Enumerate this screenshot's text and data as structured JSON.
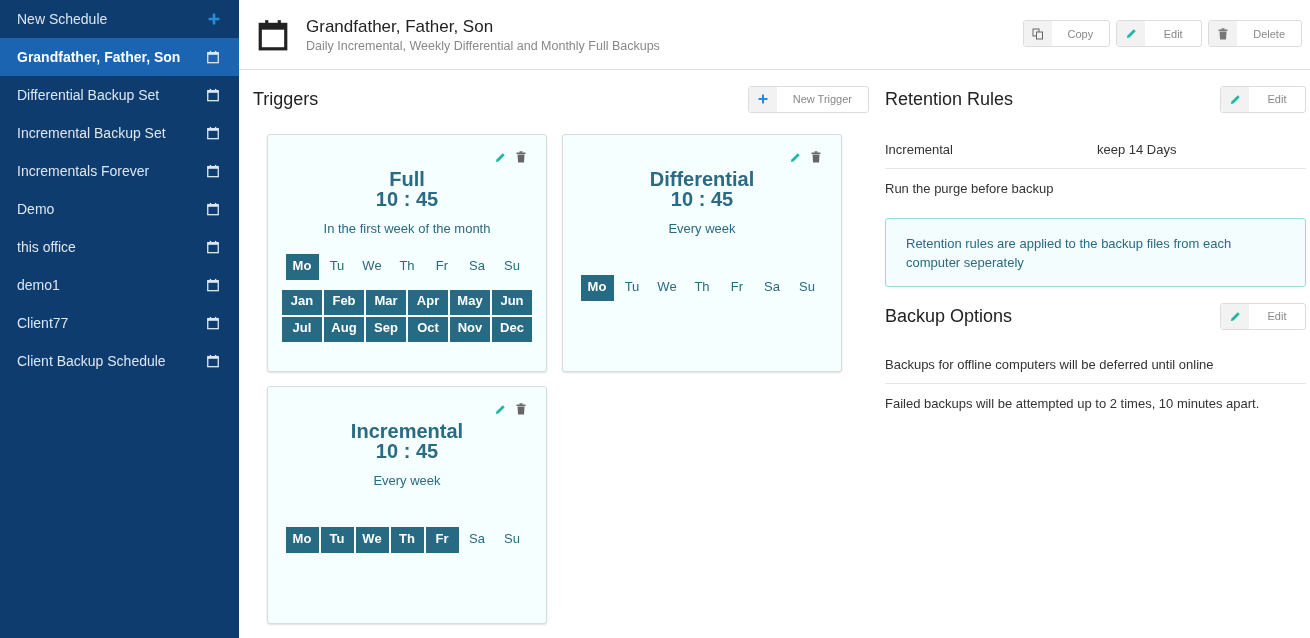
{
  "sidebar": {
    "new_item": {
      "label": "New Schedule"
    },
    "items": [
      {
        "label": "Grandfather, Father, Son",
        "selected": true
      },
      {
        "label": "Differential Backup Set",
        "selected": false
      },
      {
        "label": "Incremental Backup Set",
        "selected": false
      },
      {
        "label": "Incrementals Forever",
        "selected": false
      },
      {
        "label": "Demo",
        "selected": false
      },
      {
        "label": "this office",
        "selected": false
      },
      {
        "label": "demo1",
        "selected": false
      },
      {
        "label": "Client77",
        "selected": false
      },
      {
        "label": "Client Backup Schedule",
        "selected": false
      }
    ]
  },
  "header": {
    "title": "Grandfather, Father, Son",
    "subtitle": "Daily Incremental, Weekly Differential and Monthly Full Backups",
    "buttons": [
      {
        "kind": "copy",
        "label": "Copy"
      },
      {
        "kind": "edit",
        "label": "Edit"
      },
      {
        "kind": "delete",
        "label": "Delete"
      }
    ]
  },
  "triggers": {
    "title": "Triggers",
    "new_button": {
      "label": "New Trigger"
    },
    "cards": [
      {
        "title": "Full",
        "time": "10 : 45",
        "description": "In the first week of the month",
        "days": [
          {
            "label": "Mo",
            "selected": true
          },
          {
            "label": "Tu",
            "selected": false
          },
          {
            "label": "We",
            "selected": false
          },
          {
            "label": "Th",
            "selected": false
          },
          {
            "label": "Fr",
            "selected": false
          },
          {
            "label": "Sa",
            "selected": false
          },
          {
            "label": "Su",
            "selected": false
          }
        ],
        "months": [
          {
            "label": "Jan",
            "selected": true
          },
          {
            "label": "Feb",
            "selected": true
          },
          {
            "label": "Mar",
            "selected": true
          },
          {
            "label": "Apr",
            "selected": true
          },
          {
            "label": "May",
            "selected": true
          },
          {
            "label": "Jun",
            "selected": true
          },
          {
            "label": "Jul",
            "selected": true
          },
          {
            "label": "Aug",
            "selected": true
          },
          {
            "label": "Sep",
            "selected": true
          },
          {
            "label": "Oct",
            "selected": true
          },
          {
            "label": "Nov",
            "selected": true
          },
          {
            "label": "Dec",
            "selected": true
          }
        ]
      },
      {
        "title": "Differential",
        "time": "10 : 45",
        "description": "Every week",
        "days": [
          {
            "label": "Mo",
            "selected": true
          },
          {
            "label": "Tu",
            "selected": false
          },
          {
            "label": "We",
            "selected": false
          },
          {
            "label": "Th",
            "selected": false
          },
          {
            "label": "Fr",
            "selected": false
          },
          {
            "label": "Sa",
            "selected": false
          },
          {
            "label": "Su",
            "selected": false
          }
        ]
      },
      {
        "title": "Incremental",
        "time": "10 : 45",
        "description": "Every week",
        "days": [
          {
            "label": "Mo",
            "selected": true
          },
          {
            "label": "Tu",
            "selected": true
          },
          {
            "label": "We",
            "selected": true
          },
          {
            "label": "Th",
            "selected": true
          },
          {
            "label": "Fr",
            "selected": true
          },
          {
            "label": "Sa",
            "selected": false
          },
          {
            "label": "Su",
            "selected": false
          }
        ]
      }
    ]
  },
  "retention": {
    "title": "Retention Rules",
    "edit_button": {
      "label": "Edit"
    },
    "rule": {
      "type": "Incremental",
      "value": "keep 14 Days"
    },
    "purge_note": "Run the purge before backup",
    "info": "Retention rules are applied to the backup files from each computer seperately"
  },
  "backup_options": {
    "title": "Backup Options",
    "edit_button": {
      "label": "Edit"
    },
    "lines": [
      "Backups for offline computers will be deferred until online",
      "Failed backups will be attempted up to 2 times, 10 minutes apart."
    ]
  }
}
